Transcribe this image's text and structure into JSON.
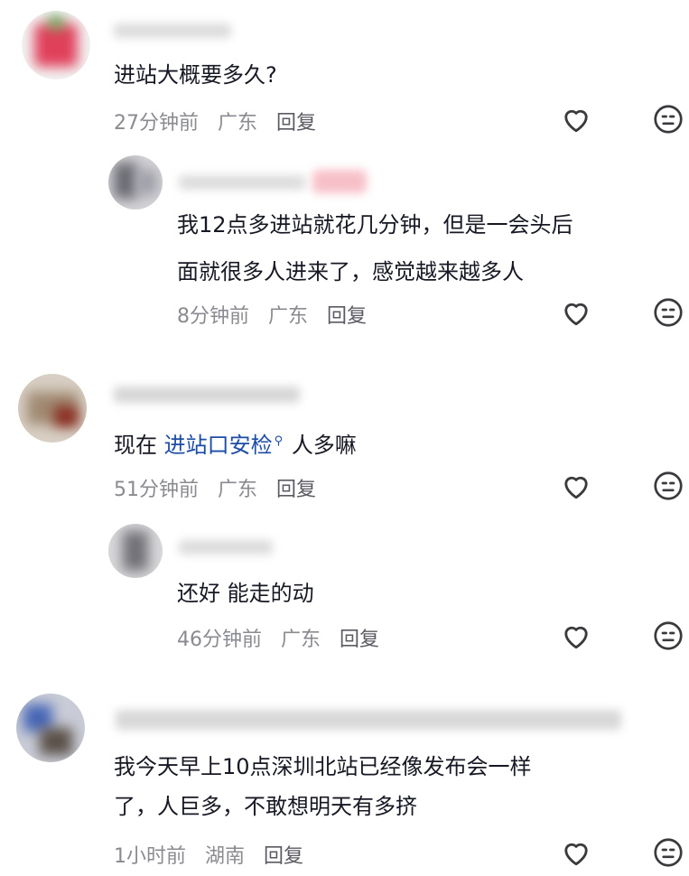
{
  "comments": [
    {
      "text": "进站大概要多久?",
      "time": "27分钟前",
      "location": "广东",
      "reply_label": "回复",
      "replies": [
        {
          "lines": [
            "我12点多进站就花几分钟，但是一会头后",
            "面就很多人进来了，感觉越来越多人"
          ],
          "time": "8分钟前",
          "location": "广东",
          "reply_label": "回复"
        }
      ]
    },
    {
      "text_prefix": "现在",
      "topic": "进站口安检",
      "text_suffix": "人多嘛",
      "time": "51分钟前",
      "location": "广东",
      "reply_label": "回复",
      "replies": [
        {
          "lines": [
            "还好 能走的动"
          ],
          "time": "46分钟前",
          "location": "广东",
          "reply_label": "回复"
        }
      ]
    },
    {
      "lines": [
        "我今天早上10点深圳北站已经像发布会一样",
        "了，人巨多，不敢想明天有多挤"
      ],
      "time": "1小时前",
      "location": "湖南",
      "reply_label": "回复"
    }
  ],
  "icons": {
    "like": "heart-outline-icon",
    "dislike": "neutral-face-icon"
  },
  "colors": {
    "topic": "#1c4ca6",
    "meta": "#8a8b91",
    "text": "#161823"
  }
}
